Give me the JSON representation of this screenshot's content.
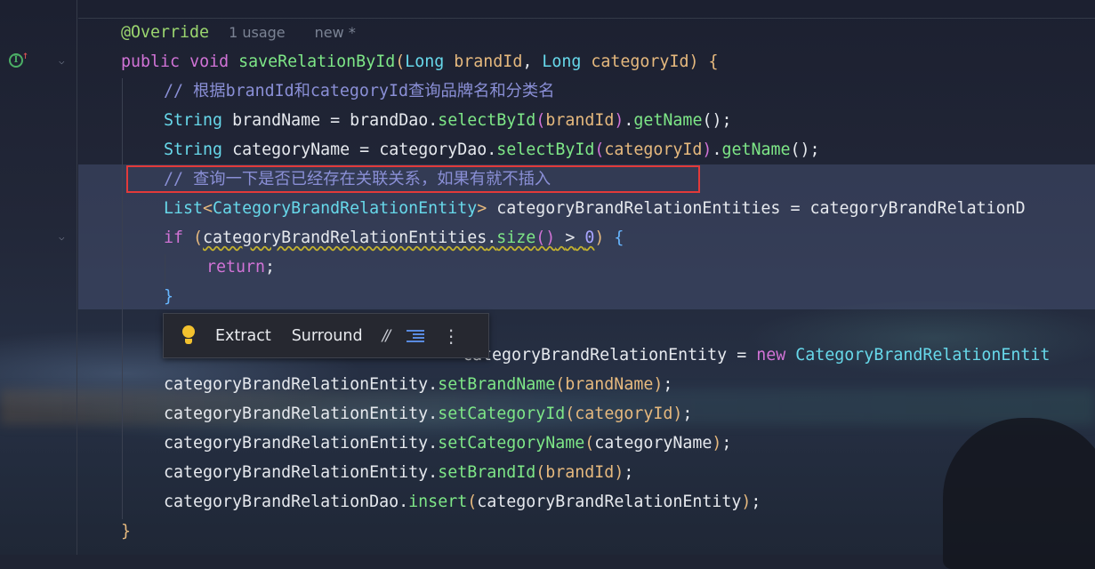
{
  "editor": {
    "line1": {
      "annotation": "@Override",
      "usages": "1 usage",
      "status": "new *"
    },
    "line2": {
      "kw1": "public",
      "kw2": "void",
      "method": "saveRelationById",
      "p1type": "Long",
      "p1": "brandId",
      "p2type": "Long",
      "p2": "categoryId"
    },
    "line3": {
      "comment": "// 根据brandId和categoryId查询品牌名和分类名"
    },
    "line4": {
      "type": "String",
      "var": "brandName",
      "eq": "=",
      "dao": "brandDao",
      "m1": "selectById",
      "arg": "brandId",
      "m2": "getName",
      "end": "();"
    },
    "line5": {
      "type": "String",
      "var": "categoryName",
      "eq": "=",
      "dao": "categoryDao",
      "m1": "selectById",
      "arg": "categoryId",
      "m2": "getName",
      "end": "();"
    },
    "line6": {
      "comment": "// 查询一下是否已经存在关联关系，如果有就不插入"
    },
    "line7": {
      "type": "List",
      "generic": "CategoryBrandRelationEntity",
      "var": "categoryBrandRelationEntities",
      "eq": "=",
      "rhs": "categoryBrandRelationD"
    },
    "line8": {
      "kw": "if",
      "obj": "categoryBrandRelationEntities",
      "method": "size",
      "op": ">",
      "num": "0"
    },
    "line9": {
      "kw": "return",
      "end": ";"
    },
    "line10": {
      "brace": "}"
    },
    "line11": {
      "tail": "categoryBrandRelationEntity",
      "eq": "=",
      "kw": "new",
      "type": "CategoryBrandRelationEntit"
    },
    "line12": {
      "obj": "categoryBrandRelationEntity",
      "method": "setBrandName",
      "arg": "brandName"
    },
    "line13": {
      "obj": "categoryBrandRelationEntity",
      "method": "setCategoryId",
      "arg": "categoryId"
    },
    "line14": {
      "obj": "categoryBrandRelationEntity",
      "method": "setCategoryName",
      "arg": "categoryName"
    },
    "line15": {
      "obj": "categoryBrandRelationEntity",
      "method": "setBrandId",
      "arg": "brandId"
    },
    "line16": {
      "obj": "categoryBrandRelationDao",
      "method": "insert",
      "arg": "categoryBrandRelationEntity"
    },
    "line17": {
      "brace": "}"
    }
  },
  "toolbar": {
    "extract_label": "Extract",
    "surround_label": "Surround",
    "comment_glyph": "//",
    "more_glyph": "⋮",
    "icons": [
      "lightbulb-icon",
      "comment-icon",
      "reformat-icon",
      "more-icon"
    ]
  },
  "colors": {
    "highlight_box": "#e23a3a",
    "keyword": "#d173d6",
    "type": "#67d8ea",
    "method": "#7ee787",
    "param": "#e6b97e",
    "comment": "#8a8fd6",
    "number": "#a8a5ff"
  }
}
